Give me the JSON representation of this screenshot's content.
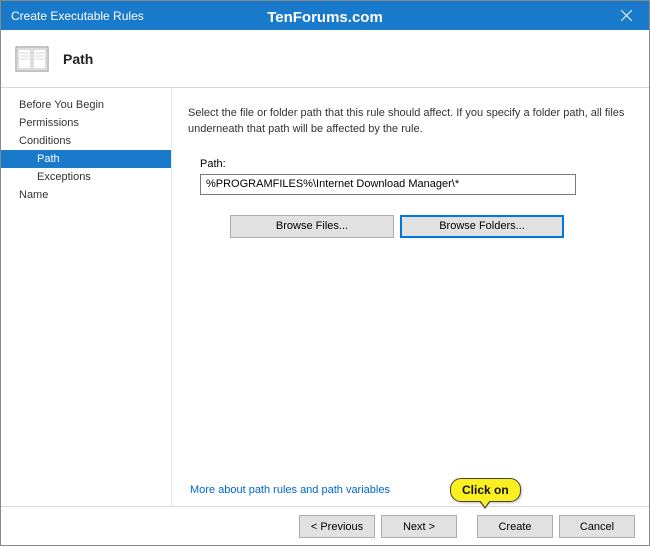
{
  "titlebar": {
    "title": "Create Executable Rules"
  },
  "watermark": "TenForums.com",
  "header": {
    "title": "Path"
  },
  "sidebar": {
    "items": [
      {
        "label": "Before You Begin",
        "selected": false
      },
      {
        "label": "Permissions",
        "selected": false
      },
      {
        "label": "Conditions",
        "selected": false,
        "children": [
          {
            "label": "Path",
            "selected": true
          },
          {
            "label": "Exceptions",
            "selected": false
          }
        ]
      },
      {
        "label": "Name",
        "selected": false
      }
    ]
  },
  "main": {
    "description": "Select the file or folder path that this rule should affect. If you specify a folder path, all files underneath that path will be affected by the rule.",
    "path_label": "Path:",
    "path_value": "%PROGRAMFILES%\\Internet Download Manager\\*",
    "browse_files": "Browse Files...",
    "browse_folders": "Browse Folders...",
    "help_link": "More about path rules and path variables"
  },
  "footer": {
    "previous": "< Previous",
    "next": "Next >",
    "create": "Create",
    "cancel": "Cancel"
  },
  "callout": {
    "text": "Click on"
  }
}
